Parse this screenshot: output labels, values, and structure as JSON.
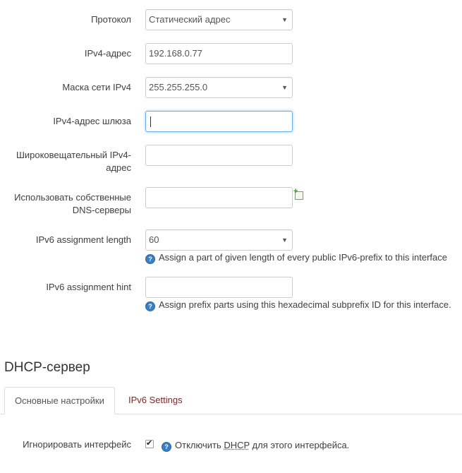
{
  "fields": {
    "protocol": {
      "label": "Протокол",
      "value": "Статический адрес"
    },
    "ipv4_address": {
      "label": "IPv4-адрес",
      "value": "192.168.0.77"
    },
    "netmask": {
      "label": "Маска сети IPv4",
      "value": "255.255.255.0"
    },
    "gateway": {
      "label": "IPv4-адрес шлюза",
      "value": ""
    },
    "broadcast": {
      "label_line1": "Широковещательный IPv4-",
      "label_line2": "адрес",
      "value": ""
    },
    "dns": {
      "label_line1": "Использовать собственные",
      "label_line2": "DNS-серверы",
      "value": ""
    },
    "ip6assign": {
      "label": "IPv6 assignment length",
      "value": "60",
      "hint": "Assign a part of given length of every public IPv6-prefix to this interface"
    },
    "ip6hint": {
      "label": "IPv6 assignment hint",
      "value": "",
      "hint": "Assign prefix parts using this hexadecimal subprefix ID for this interface."
    }
  },
  "dhcp": {
    "title": "DHCP-сервер",
    "tabs": [
      {
        "label": "Основные настройки",
        "active": true
      },
      {
        "label": "IPv6 Settings",
        "active": false
      }
    ],
    "ignore": {
      "label": "Игнорировать интерфейс",
      "checked": true,
      "hint_before": "Отключить ",
      "hint_abbr": "DHCP",
      "hint_after": " для этого интерфейса."
    }
  },
  "icons": {
    "help": "help-icon",
    "add": "add-icon",
    "caret": "caret-down-icon"
  },
  "colors": {
    "focus": "#66afe9",
    "help_icon": "#3a7fc1",
    "inactive_tab": "#7a2a2a"
  }
}
